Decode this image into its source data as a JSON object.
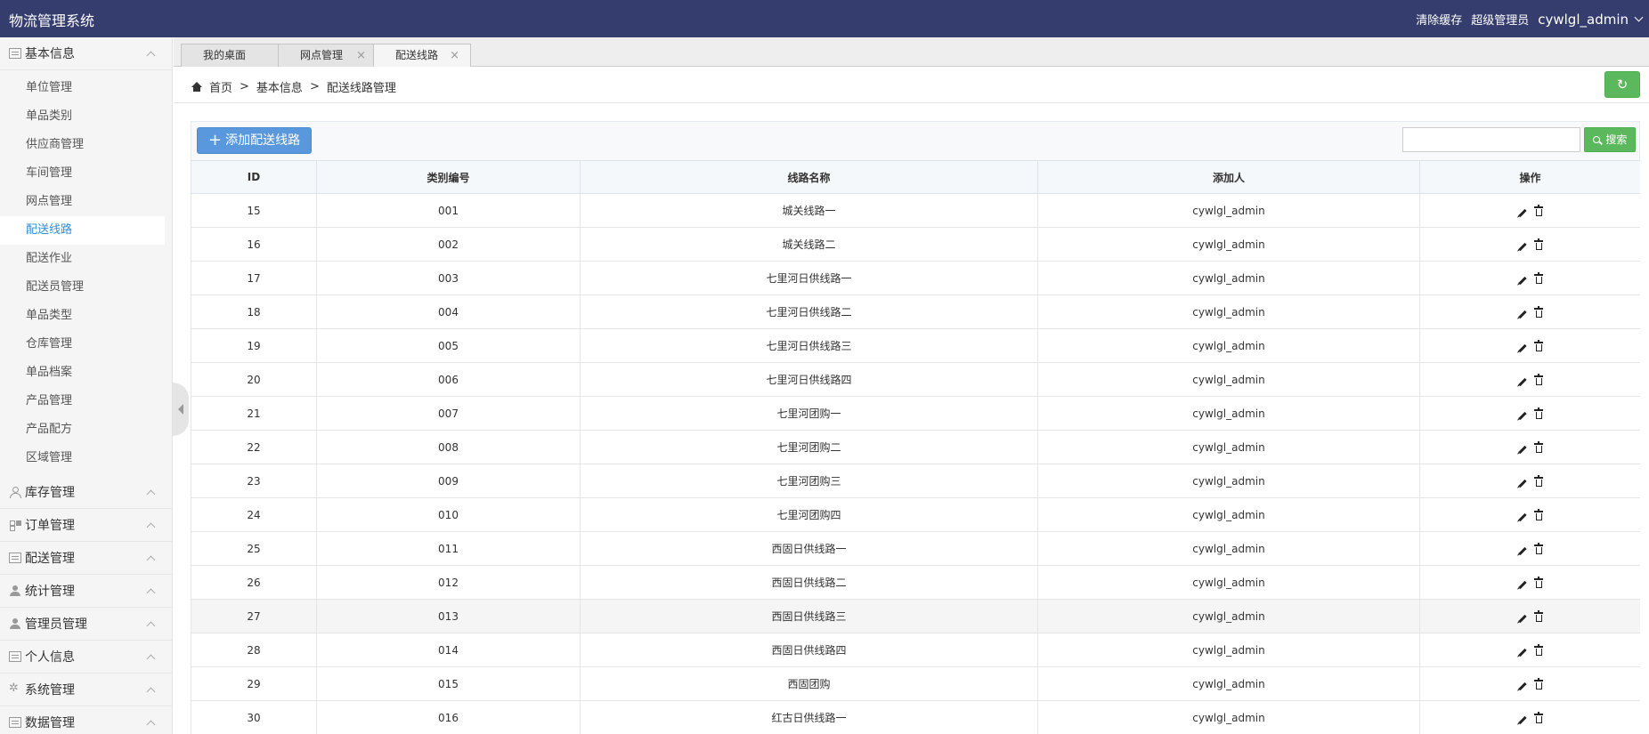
{
  "header": {
    "title": "物流管理系统",
    "clear_cache": "清除缓存",
    "role": "超级管理员",
    "username": "cywlgl_admin"
  },
  "sidebar": {
    "sections": [
      {
        "label": "基本信息",
        "icon": "list-icon",
        "expanded": true
      },
      {
        "label": "库存管理",
        "icon": "user-outline-icon"
      },
      {
        "label": "订单管理",
        "icon": "grid-icon"
      },
      {
        "label": "配送管理",
        "icon": "list-icon"
      },
      {
        "label": "统计管理",
        "icon": "user-icon"
      },
      {
        "label": "管理员管理",
        "icon": "user-icon"
      },
      {
        "label": "个人信息",
        "icon": "list-icon"
      },
      {
        "label": "系统管理",
        "icon": "gear-icon"
      },
      {
        "label": "数据管理",
        "icon": "list-icon"
      }
    ],
    "items": [
      "单位管理",
      "单品类别",
      "供应商管理",
      "车间管理",
      "网点管理",
      "配送线路",
      "配送作业",
      "配送员管理",
      "单品类型",
      "仓库管理",
      "单品档案",
      "产品管理",
      "产品配方",
      "区域管理"
    ],
    "active_item": "配送线路"
  },
  "tabs": [
    {
      "label": "我的桌面"
    },
    {
      "label": "网点管理",
      "close": "×"
    },
    {
      "label": "配送线路",
      "close": "×",
      "active": true
    }
  ],
  "breadcrumb": {
    "home": "首页",
    "sep": ">",
    "level1": "基本信息",
    "level2": "配送线路管理"
  },
  "toolbar": {
    "add_label": "添加配送线路",
    "search_placeholder": "",
    "search_label": "搜索"
  },
  "colors": {
    "header_bg": "#353d6e",
    "primary": "#5a98de",
    "success": "#5cb85c",
    "active_link": "#2c8fd8"
  },
  "table": {
    "columns": [
      "ID",
      "类别编号",
      "线路名称",
      "添加人",
      "操作"
    ],
    "rows": [
      [
        "15",
        "001",
        "城关线路一",
        "cywlgl_admin"
      ],
      [
        "16",
        "002",
        "城关线路二",
        "cywlgl_admin"
      ],
      [
        "17",
        "003",
        "七里河日供线路一",
        "cywlgl_admin"
      ],
      [
        "18",
        "004",
        "七里河日供线路二",
        "cywlgl_admin"
      ],
      [
        "19",
        "005",
        "七里河日供线路三",
        "cywlgl_admin"
      ],
      [
        "20",
        "006",
        "七里河日供线路四",
        "cywlgl_admin"
      ],
      [
        "21",
        "007",
        "七里河团购一",
        "cywlgl_admin"
      ],
      [
        "22",
        "008",
        "七里河团购二",
        "cywlgl_admin"
      ],
      [
        "23",
        "009",
        "七里河团购三",
        "cywlgl_admin"
      ],
      [
        "24",
        "010",
        "七里河团购四",
        "cywlgl_admin"
      ],
      [
        "25",
        "011",
        "西固日供线路一",
        "cywlgl_admin"
      ],
      [
        "26",
        "012",
        "西固日供线路二",
        "cywlgl_admin"
      ],
      [
        "27",
        "013",
        "西固日供线路三",
        "cywlgl_admin"
      ],
      [
        "28",
        "014",
        "西固日供线路四",
        "cywlgl_admin"
      ],
      [
        "29",
        "015",
        "西固团购",
        "cywlgl_admin"
      ],
      [
        "30",
        "016",
        "红古日供线路一",
        "cywlgl_admin"
      ]
    ],
    "highlighted_row": 12
  }
}
